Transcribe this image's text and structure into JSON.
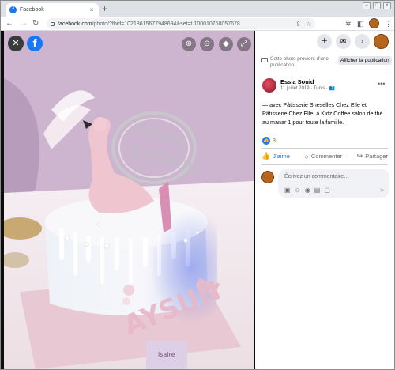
{
  "browser": {
    "tab_title": "Facebook",
    "tab_favicon": "f",
    "tab_close": "×",
    "new_tab": "+",
    "url_host": "facebook.com",
    "url_rest": "/photo/?fbid=10218615677948694&set=t.100010768057678",
    "window_controls": [
      "–",
      "□",
      "×"
    ]
  },
  "viewer": {
    "close_glyph": "✕",
    "logo_letter": "f",
    "controls": [
      "zoom-in-icon",
      "zoom-out-icon",
      "tag-icon",
      "fullscreen-icon"
    ]
  },
  "header_icons": [
    "create-icon",
    "messenger-icon",
    "notifications-icon",
    "account-avatar"
  ],
  "publication_note": {
    "text": "Cette photo provient d’une publication.",
    "button": "Afficher la publication"
  },
  "post": {
    "author": "Essia Souid",
    "meta": "11 juillet 2019 · Tunis ·",
    "caption": "— avec Pâtisserie Sheselles Chez Elle et Pâtisserie Chez Elle. à Kidz Coffee salon de thé au manar 1 pour toute la famille.",
    "reaction_count": "3",
    "actions": {
      "like": "J’aime",
      "comment": "Commenter",
      "share": "Partager"
    }
  },
  "composer": {
    "placeholder": "Écrivez un commentaire…"
  },
  "colors": {
    "facebook_blue": "#1877f2",
    "viewer_bg": "#0d0d0d",
    "secondary_text": "#65676b"
  }
}
